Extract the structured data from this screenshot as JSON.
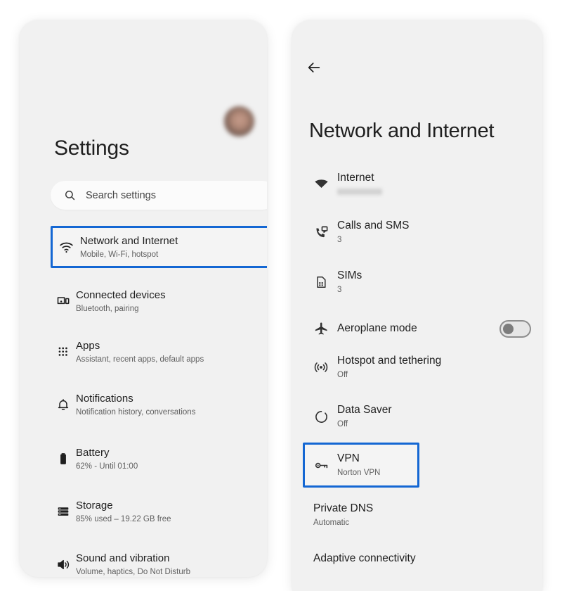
{
  "colors": {
    "highlight_blue": "#1467d3",
    "panel_bg": "#f1f1f1",
    "search_bg": "#fbfbfb",
    "title_text": "#1f1f1f",
    "subtitle_text": "#606060",
    "toggle_off_track": "#e6e6e6",
    "toggle_off_knob": "#7c7c7c"
  },
  "left_panel": {
    "title": "Settings",
    "avatar": {
      "icon": "account-avatar",
      "redacted": true
    },
    "search": {
      "icon": "search-icon",
      "placeholder": "Search settings",
      "value": ""
    },
    "items": [
      {
        "icon": "wifi-icon",
        "title": "Network and Internet",
        "subtitle": "Mobile, Wi-Fi, hotspot",
        "highlighted": true
      },
      {
        "icon": "connected-devices-icon",
        "title": "Connected devices",
        "subtitle": "Bluetooth, pairing",
        "highlighted": false
      },
      {
        "icon": "apps-grid-icon",
        "title": "Apps",
        "subtitle": "Assistant, recent apps, default apps",
        "highlighted": false
      },
      {
        "icon": "bell-icon",
        "title": "Notifications",
        "subtitle": "Notification history, conversations",
        "highlighted": false
      },
      {
        "icon": "battery-icon",
        "title": "Battery",
        "subtitle": "62% - Until 01:00",
        "highlighted": false
      },
      {
        "icon": "storage-icon",
        "title": "Storage",
        "subtitle": "85% used – 19.22 GB free",
        "highlighted": false
      },
      {
        "icon": "volume-icon",
        "title": "Sound and vibration",
        "subtitle": "Volume, haptics, Do Not Disturb",
        "highlighted": false
      }
    ]
  },
  "right_panel": {
    "back": {
      "icon": "back-arrow-icon",
      "label": "Back"
    },
    "title": "Network and Internet",
    "items": [
      {
        "icon": "wifi-filled-icon",
        "title": "Internet",
        "subtitle": "",
        "subtitle_redacted": true,
        "highlighted": false,
        "toggle": null
      },
      {
        "icon": "calls-sms-icon",
        "title": "Calls and SMS",
        "subtitle": "3",
        "highlighted": false,
        "toggle": null
      },
      {
        "icon": "sim-card-icon",
        "title": "SIMs",
        "subtitle": "3",
        "highlighted": false,
        "toggle": null
      },
      {
        "icon": "airplane-icon",
        "title": "Aeroplane mode",
        "subtitle": "",
        "highlighted": false,
        "toggle": "off"
      },
      {
        "icon": "hotspot-icon",
        "title": "Hotspot and tethering",
        "subtitle": "Off",
        "highlighted": false,
        "toggle": null
      },
      {
        "icon": "data-saver-icon",
        "title": "Data Saver",
        "subtitle": "Off",
        "highlighted": false,
        "toggle": null
      },
      {
        "icon": "key-icon",
        "title": "VPN",
        "subtitle": "Norton VPN",
        "highlighted": true,
        "toggle": null
      },
      {
        "icon": "",
        "title": "Private DNS",
        "subtitle": "Automatic",
        "highlighted": false,
        "toggle": null
      },
      {
        "icon": "",
        "title": "Adaptive connectivity",
        "subtitle": "",
        "highlighted": false,
        "toggle": null
      }
    ]
  }
}
